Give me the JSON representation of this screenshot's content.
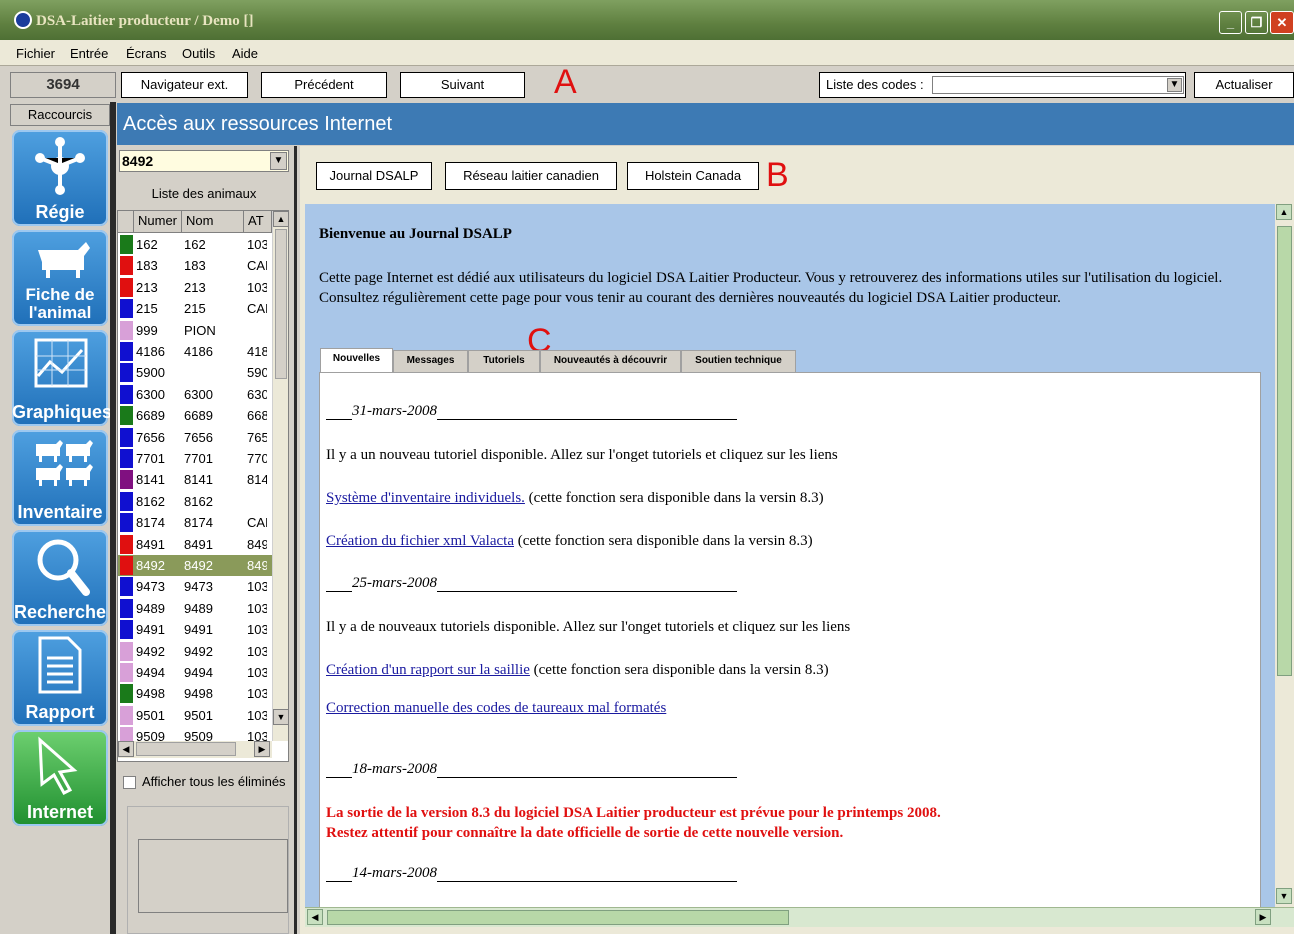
{
  "window": {
    "title": "DSA-Laitier producteur / Demo []"
  },
  "menu": [
    "Fichier",
    "Entrée",
    "Écrans",
    "Outils",
    "Aide"
  ],
  "toolbar": {
    "counter": "3694",
    "nav_ext": "Navigateur ext.",
    "prev": "Précédent",
    "next": "Suivant",
    "codes_label": "Liste des codes :",
    "codes_value": "",
    "refresh": "Actualiser"
  },
  "annotations": {
    "a": "A",
    "b": "B",
    "c": "C"
  },
  "sidebar": {
    "title": "Raccourcis",
    "items": [
      "Régie",
      "Fiche de l'animal",
      "Graphiques",
      "Inventaire",
      "Recherche",
      "Rapport",
      "Internet"
    ]
  },
  "header": {
    "title": "Accès aux ressources Internet"
  },
  "animals": {
    "herd": "8492",
    "list_title": "Liste des animaux",
    "columns": [
      "Numer",
      "Nom",
      "AT"
    ],
    "rows": [
      {
        "num": "162",
        "nom": "162",
        "at": "103",
        "color": "#1a7a1a"
      },
      {
        "num": "183",
        "nom": "183",
        "at": "CAI",
        "color": "#e01010"
      },
      {
        "num": "213",
        "nom": "213",
        "at": "103",
        "color": "#e01010"
      },
      {
        "num": "215",
        "nom": "215",
        "at": "CAI",
        "color": "#1010d0"
      },
      {
        "num": "999",
        "nom": "PION",
        "at": "",
        "color": "#d8a0d8"
      },
      {
        "num": "4186",
        "nom": "4186",
        "at": "418",
        "color": "#1010d0"
      },
      {
        "num": "5900",
        "nom": "",
        "at": "590",
        "color": "#1010d0"
      },
      {
        "num": "6300",
        "nom": "6300",
        "at": "630",
        "color": "#1010d0"
      },
      {
        "num": "6689",
        "nom": "6689",
        "at": "668",
        "color": "#1a7a1a"
      },
      {
        "num": "7656",
        "nom": "7656",
        "at": "765",
        "color": "#1010d0"
      },
      {
        "num": "7701",
        "nom": "7701",
        "at": "770",
        "color": "#1010d0"
      },
      {
        "num": "8141",
        "nom": "8141",
        "at": "814",
        "color": "#801080"
      },
      {
        "num": "8162",
        "nom": "8162",
        "at": "",
        "color": "#1010d0"
      },
      {
        "num": "8174",
        "nom": "8174",
        "at": "CAI",
        "color": "#1010d0"
      },
      {
        "num": "8491",
        "nom": "8491",
        "at": "849",
        "color": "#e01010"
      },
      {
        "num": "8492",
        "nom": "8492",
        "at": "849",
        "color": "#e01010",
        "selected": true
      },
      {
        "num": "9473",
        "nom": "9473",
        "at": "103",
        "color": "#1010d0"
      },
      {
        "num": "9489",
        "nom": "9489",
        "at": "103",
        "color": "#1010d0"
      },
      {
        "num": "9491",
        "nom": "9491",
        "at": "103",
        "color": "#1010d0"
      },
      {
        "num": "9492",
        "nom": "9492",
        "at": "103",
        "color": "#d8a0d8"
      },
      {
        "num": "9494",
        "nom": "9494",
        "at": "103",
        "color": "#d8a0d8"
      },
      {
        "num": "9498",
        "nom": "9498",
        "at": "103",
        "color": "#1a7a1a"
      },
      {
        "num": "9501",
        "nom": "9501",
        "at": "103",
        "color": "#d8a0d8"
      },
      {
        "num": "9509",
        "nom": "9509",
        "at": "103",
        "color": "#d8a0d8"
      }
    ],
    "show_eliminated": "Afficher tous les éliminés"
  },
  "links": [
    "Journal DSALP",
    "Réseau laitier canadien",
    "Holstein Canada"
  ],
  "web": {
    "welcome": "Bienvenue au Journal DSALP",
    "intro": "Cette page Internet est dédié aux utilisateurs du logiciel DSA Laitier Producteur. Vous y retrouverez des informations utiles sur l'utilisation du logiciel. Consultez régulièrement cette page pour vous tenir au courant des dernières nouveautés du logiciel DSA Laitier producteur.",
    "tabs": [
      "Nouvelles",
      "Messages",
      "Tutoriels",
      "Nouveautés à découvrir",
      "Soutien technique"
    ],
    "news": {
      "d1": "31-mars-2008",
      "t1": "Il y a un nouveau tutoriel disponible. Allez sur l'onget tutoriels et cliquez sur les liens",
      "l1": "Système d'inventaire individuels.",
      "n1": " (cette fonction sera disponible dans la versin 8.3)",
      "l2": "Création du fichier xml Valacta",
      "n2": " (cette fonction sera disponible dans la versin 8.3)",
      "d2": "25-mars-2008",
      "t2": "Il y a de nouveaux tutoriels disponible. Allez sur l'onget tutoriels et cliquez sur les liens",
      "l3": "Création d'un rapport sur la saillie",
      "n3": " (cette fonction sera disponible dans la versin 8.3)",
      "l4": "Correction manuelle des codes de taureaux mal formatés",
      "d3": "18-mars-2008",
      "r1": "La sortie de la version 8.3 du logiciel DSA Laitier producteur est prévue pour le printemps 2008.",
      "r2": "Restez attentif pour connaître la date officielle de sortie de cette nouvelle version.",
      "d4": "14-mars-2008"
    }
  }
}
